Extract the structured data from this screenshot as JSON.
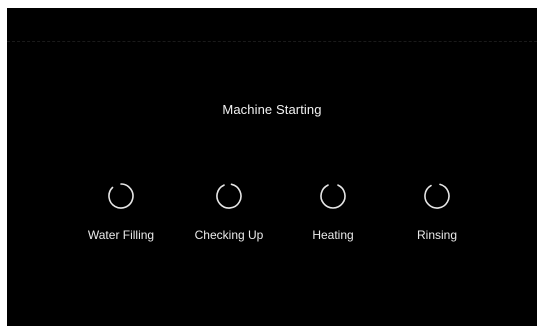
{
  "colors": {
    "background": "#000000",
    "text": "#eaeaea",
    "spinner": "#e6e6e6"
  },
  "status": {
    "title": "Machine Starting"
  },
  "steps": [
    {
      "label": "Water Filling",
      "icon": "spinner-icon"
    },
    {
      "label": "Checking Up",
      "icon": "spinner-icon"
    },
    {
      "label": "Heating",
      "icon": "spinner-icon"
    },
    {
      "label": "Rinsing",
      "icon": "spinner-icon"
    }
  ]
}
